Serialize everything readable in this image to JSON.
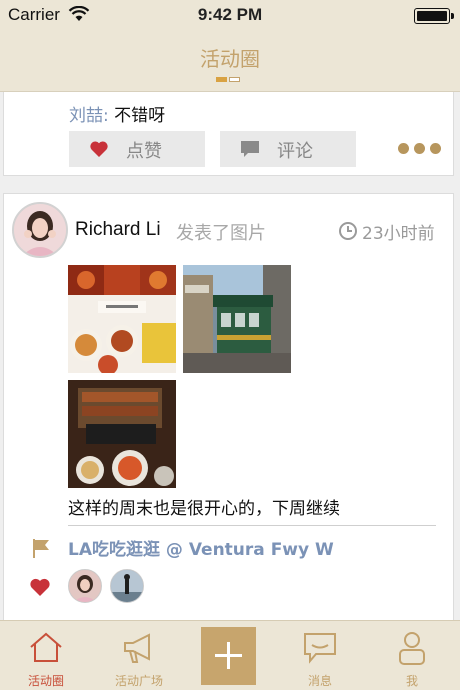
{
  "status_bar": {
    "carrier": "Carrier",
    "time": "9:42 PM",
    "battery_level": 1.0
  },
  "nav": {
    "title": "活动圈",
    "page_indicator": {
      "count": 2,
      "active": 0
    }
  },
  "feed": {
    "prev_post": {
      "comment_name": "刘喆:",
      "comment_text": " 不错呀",
      "like_label": "点赞",
      "comment_label": "评论",
      "more_icon": "more-dots-icon"
    },
    "post": {
      "username": "Richard Li",
      "action": "发表了图片",
      "time": "23小时前",
      "text": "这样的周末也是很开心的，下周继续",
      "location": "LA吃吃逛逛 @ Ventura Fwy W",
      "next_post_partial": "..."
    }
  },
  "tab_bar": {
    "tabs": [
      {
        "label": "活动圈",
        "icon": "home-icon",
        "active": true
      },
      {
        "label": "活动广场",
        "icon": "megaphone-icon",
        "active": false
      },
      {
        "label": "",
        "icon": "plus-icon",
        "active": false
      },
      {
        "label": "消息",
        "icon": "chat-bubble-icon",
        "active": false
      },
      {
        "label": "我",
        "icon": "user-icon",
        "active": false
      }
    ]
  },
  "colors": {
    "accent": "#c3a26c",
    "bar_background": "#ece6d6",
    "link_blue": "#7b92b6",
    "like_red": "#c8323a",
    "active_tab": "#c8503a"
  }
}
